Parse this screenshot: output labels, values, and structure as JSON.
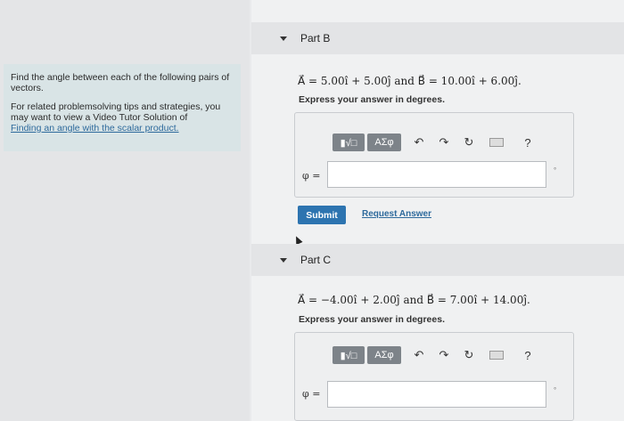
{
  "problem": {
    "intro_text": "Find the angle between each of the following pairs of vectors.",
    "tips_text": "For related problemsolving tips and strategies, you may want to view a Video Tutor Solution of",
    "tips_link": "Finding an angle with the scalar product."
  },
  "part_b": {
    "label": "Part B",
    "equation": "A⃗ = 5.00î + 5.00ĵ  and  B⃗ = 10.00î + 6.00ĵ.",
    "instruction": "Express your answer in degrees.",
    "answer_label": "φ =",
    "answer_value": "",
    "unit": "°",
    "submit_label": "Submit",
    "request_label": "Request Answer"
  },
  "part_c": {
    "label": "Part C",
    "equation": "A⃗ = −4.00î + 2.00ĵ  and  B⃗ = 7.00î + 14.00ĵ.",
    "instruction": "Express your answer in degrees.",
    "answer_label": "φ =",
    "answer_value": "",
    "unit": "°"
  },
  "toolbar": {
    "templates_label": "▮√□",
    "greek_label": "ΑΣφ",
    "undo_icon": "↶",
    "redo_icon": "↷",
    "reset_icon": "↻",
    "help_label": "?"
  }
}
